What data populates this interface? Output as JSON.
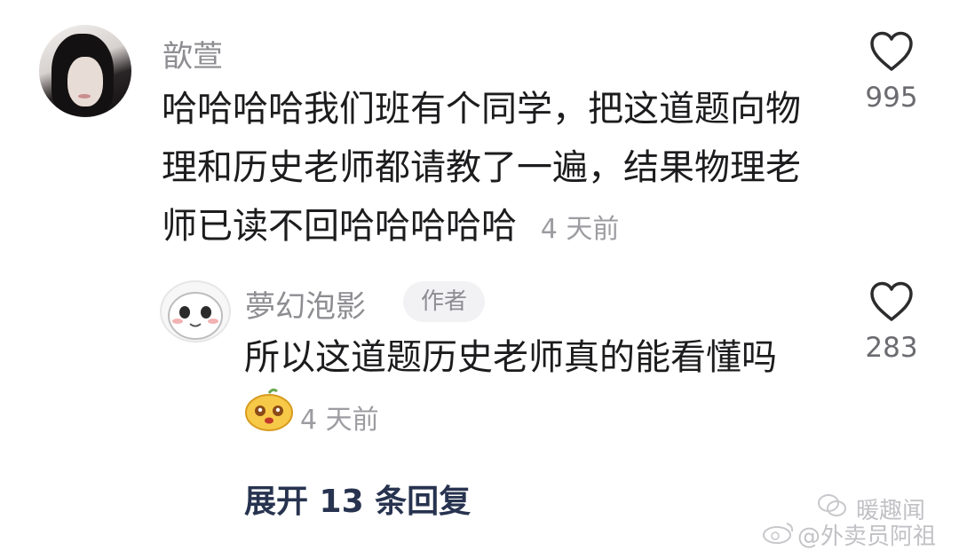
{
  "comment": {
    "username": "歆萱",
    "text_lines": [
      "哈哈哈哈我们班有个同学，把这道题向物",
      "理和历史老师都请教了一遍，结果物理老",
      "师已读不回哈哈哈哈哈"
    ],
    "time": "4 天前",
    "like_count": "995"
  },
  "reply": {
    "username": "夢幻泡影",
    "badge": "作者",
    "text": "所以这道题历史老师真的能看懂吗",
    "time": "4 天前",
    "like_count": "283"
  },
  "expand_replies": "展开 13 条回复",
  "watermark": {
    "line1": "暖趣闻",
    "line2": "@外卖员阿祖"
  },
  "icons": [
    "avatar",
    "heart-icon",
    "emoji-sticker-icon",
    "weibo-logo-icon",
    "wechat-logo-icon"
  ]
}
